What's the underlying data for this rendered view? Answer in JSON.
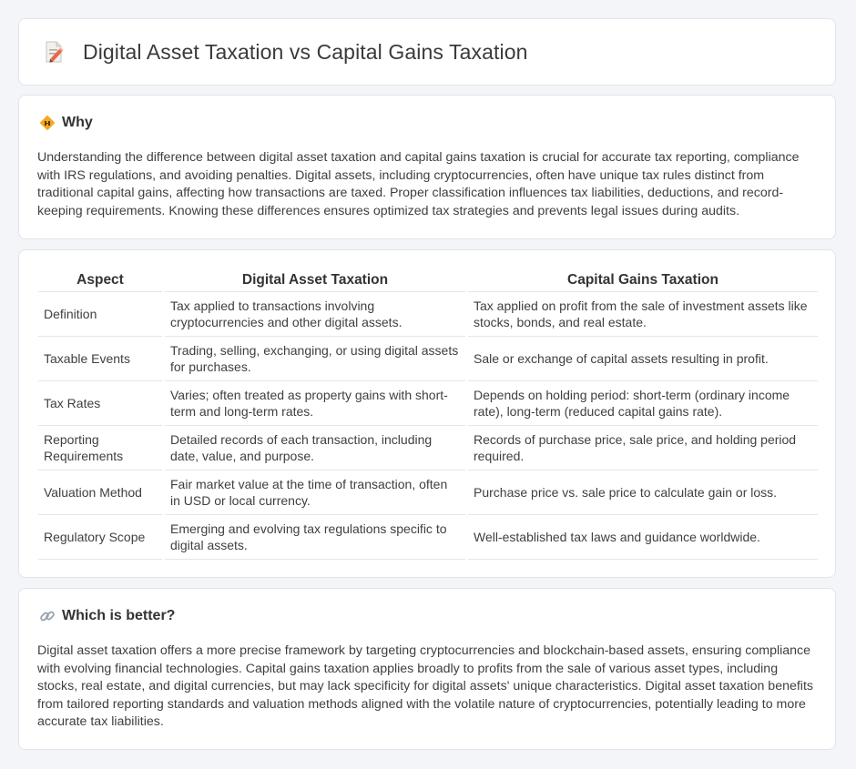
{
  "header": {
    "title": "Digital Asset Taxation vs Capital Gains Taxation"
  },
  "why": {
    "heading": "Why",
    "text": "Understanding the difference between digital asset taxation and capital gains taxation is crucial for accurate tax reporting, compliance with IRS regulations, and avoiding penalties. Digital assets, including cryptocurrencies, often have unique tax rules distinct from traditional capital gains, affecting how transactions are taxed. Proper classification influences tax liabilities, deductions, and record-keeping requirements. Knowing these differences ensures optimized tax strategies and prevents legal issues during audits."
  },
  "table": {
    "headers": [
      "Aspect",
      "Digital Asset Taxation",
      "Capital Gains Taxation"
    ],
    "rows": [
      [
        "Definition",
        "Tax applied to transactions involving cryptocurrencies and other digital assets.",
        "Tax applied on profit from the sale of investment assets like stocks, bonds, and real estate."
      ],
      [
        "Taxable Events",
        "Trading, selling, exchanging, or using digital assets for purchases.",
        "Sale or exchange of capital assets resulting in profit."
      ],
      [
        "Tax Rates",
        "Varies; often treated as property gains with short-term and long-term rates.",
        "Depends on holding period: short-term (ordinary income rate), long-term (reduced capital gains rate)."
      ],
      [
        "Reporting Requirements",
        "Detailed records of each transaction, including date, value, and purpose.",
        "Records of purchase price, sale price, and holding period required."
      ],
      [
        "Valuation Method",
        "Fair market value at the time of transaction, often in USD or local currency.",
        "Purchase price vs. sale price to calculate gain or loss."
      ],
      [
        "Regulatory Scope",
        "Emerging and evolving tax regulations specific to digital assets.",
        "Well-established tax laws and guidance worldwide."
      ]
    ]
  },
  "better": {
    "heading": "Which is better?",
    "text": "Digital asset taxation offers a more precise framework by targeting cryptocurrencies and blockchain-based assets, ensuring compliance with evolving financial technologies. Capital gains taxation applies broadly to profits from the sale of various asset types, including stocks, real estate, and digital currencies, but may lack specificity for digital assets' unique characteristics. Digital asset taxation benefits from tailored reporting standards and valuation methods aligned with the volatile nature of cryptocurrencies, potentially leading to more accurate tax liabilities."
  },
  "icons": {
    "title": "memo-pencil-icon",
    "why": "diamond-sign-icon",
    "better": "link-icon"
  }
}
